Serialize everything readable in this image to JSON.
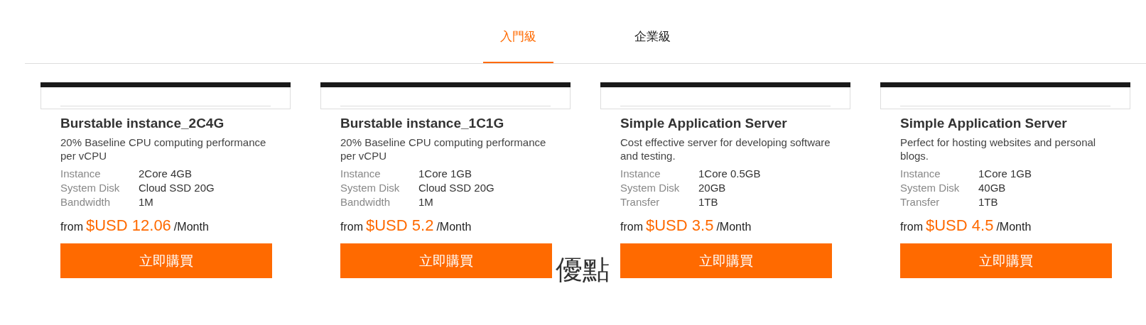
{
  "tabs": [
    {
      "label": "入門級",
      "selected": true
    },
    {
      "label": "企業級",
      "selected": false
    }
  ],
  "plans": [
    {
      "title": "Burstable instance_2C4G",
      "description": "20% Baseline CPU computing performance per vCPU",
      "specs": [
        {
          "label": "Instance",
          "value": "2Core 4GB"
        },
        {
          "label": "System Disk",
          "value": "Cloud SSD 20G"
        },
        {
          "label": "Bandwidth",
          "value": "1M"
        }
      ],
      "price_prefix": "from",
      "price": "$USD 12.06",
      "price_unit": "/Month",
      "button": "立即購買"
    },
    {
      "title": "Burstable instance_1C1G",
      "description": "20% Baseline CPU computing performance per vCPU",
      "specs": [
        {
          "label": "Instance",
          "value": "1Core 1GB"
        },
        {
          "label": "System Disk",
          "value": "Cloud SSD 20G"
        },
        {
          "label": "Bandwidth",
          "value": "1M"
        }
      ],
      "price_prefix": "from",
      "price": "$USD 5.2",
      "price_unit": "/Month",
      "button": "立即購買"
    },
    {
      "title": "Simple Application Server",
      "description": "Cost effective server for developing software and testing.",
      "specs": [
        {
          "label": "Instance",
          "value": "1Core 0.5GB"
        },
        {
          "label": "System Disk",
          "value": "20GB"
        },
        {
          "label": "Transfer",
          "value": "1TB"
        }
      ],
      "price_prefix": "from",
      "price": "$USD 3.5",
      "price_unit": "/Month",
      "button": "立即購買"
    },
    {
      "title": "Simple Application Server",
      "description": "Perfect for hosting websites and personal blogs.",
      "specs": [
        {
          "label": "Instance",
          "value": "1Core 1GB"
        },
        {
          "label": "System Disk",
          "value": "40GB"
        },
        {
          "label": "Transfer",
          "value": "1TB"
        }
      ],
      "price_prefix": "from",
      "price": "$USD 4.5",
      "price_unit": "/Month",
      "button": "立即購買"
    }
  ],
  "section_heading": "優點"
}
